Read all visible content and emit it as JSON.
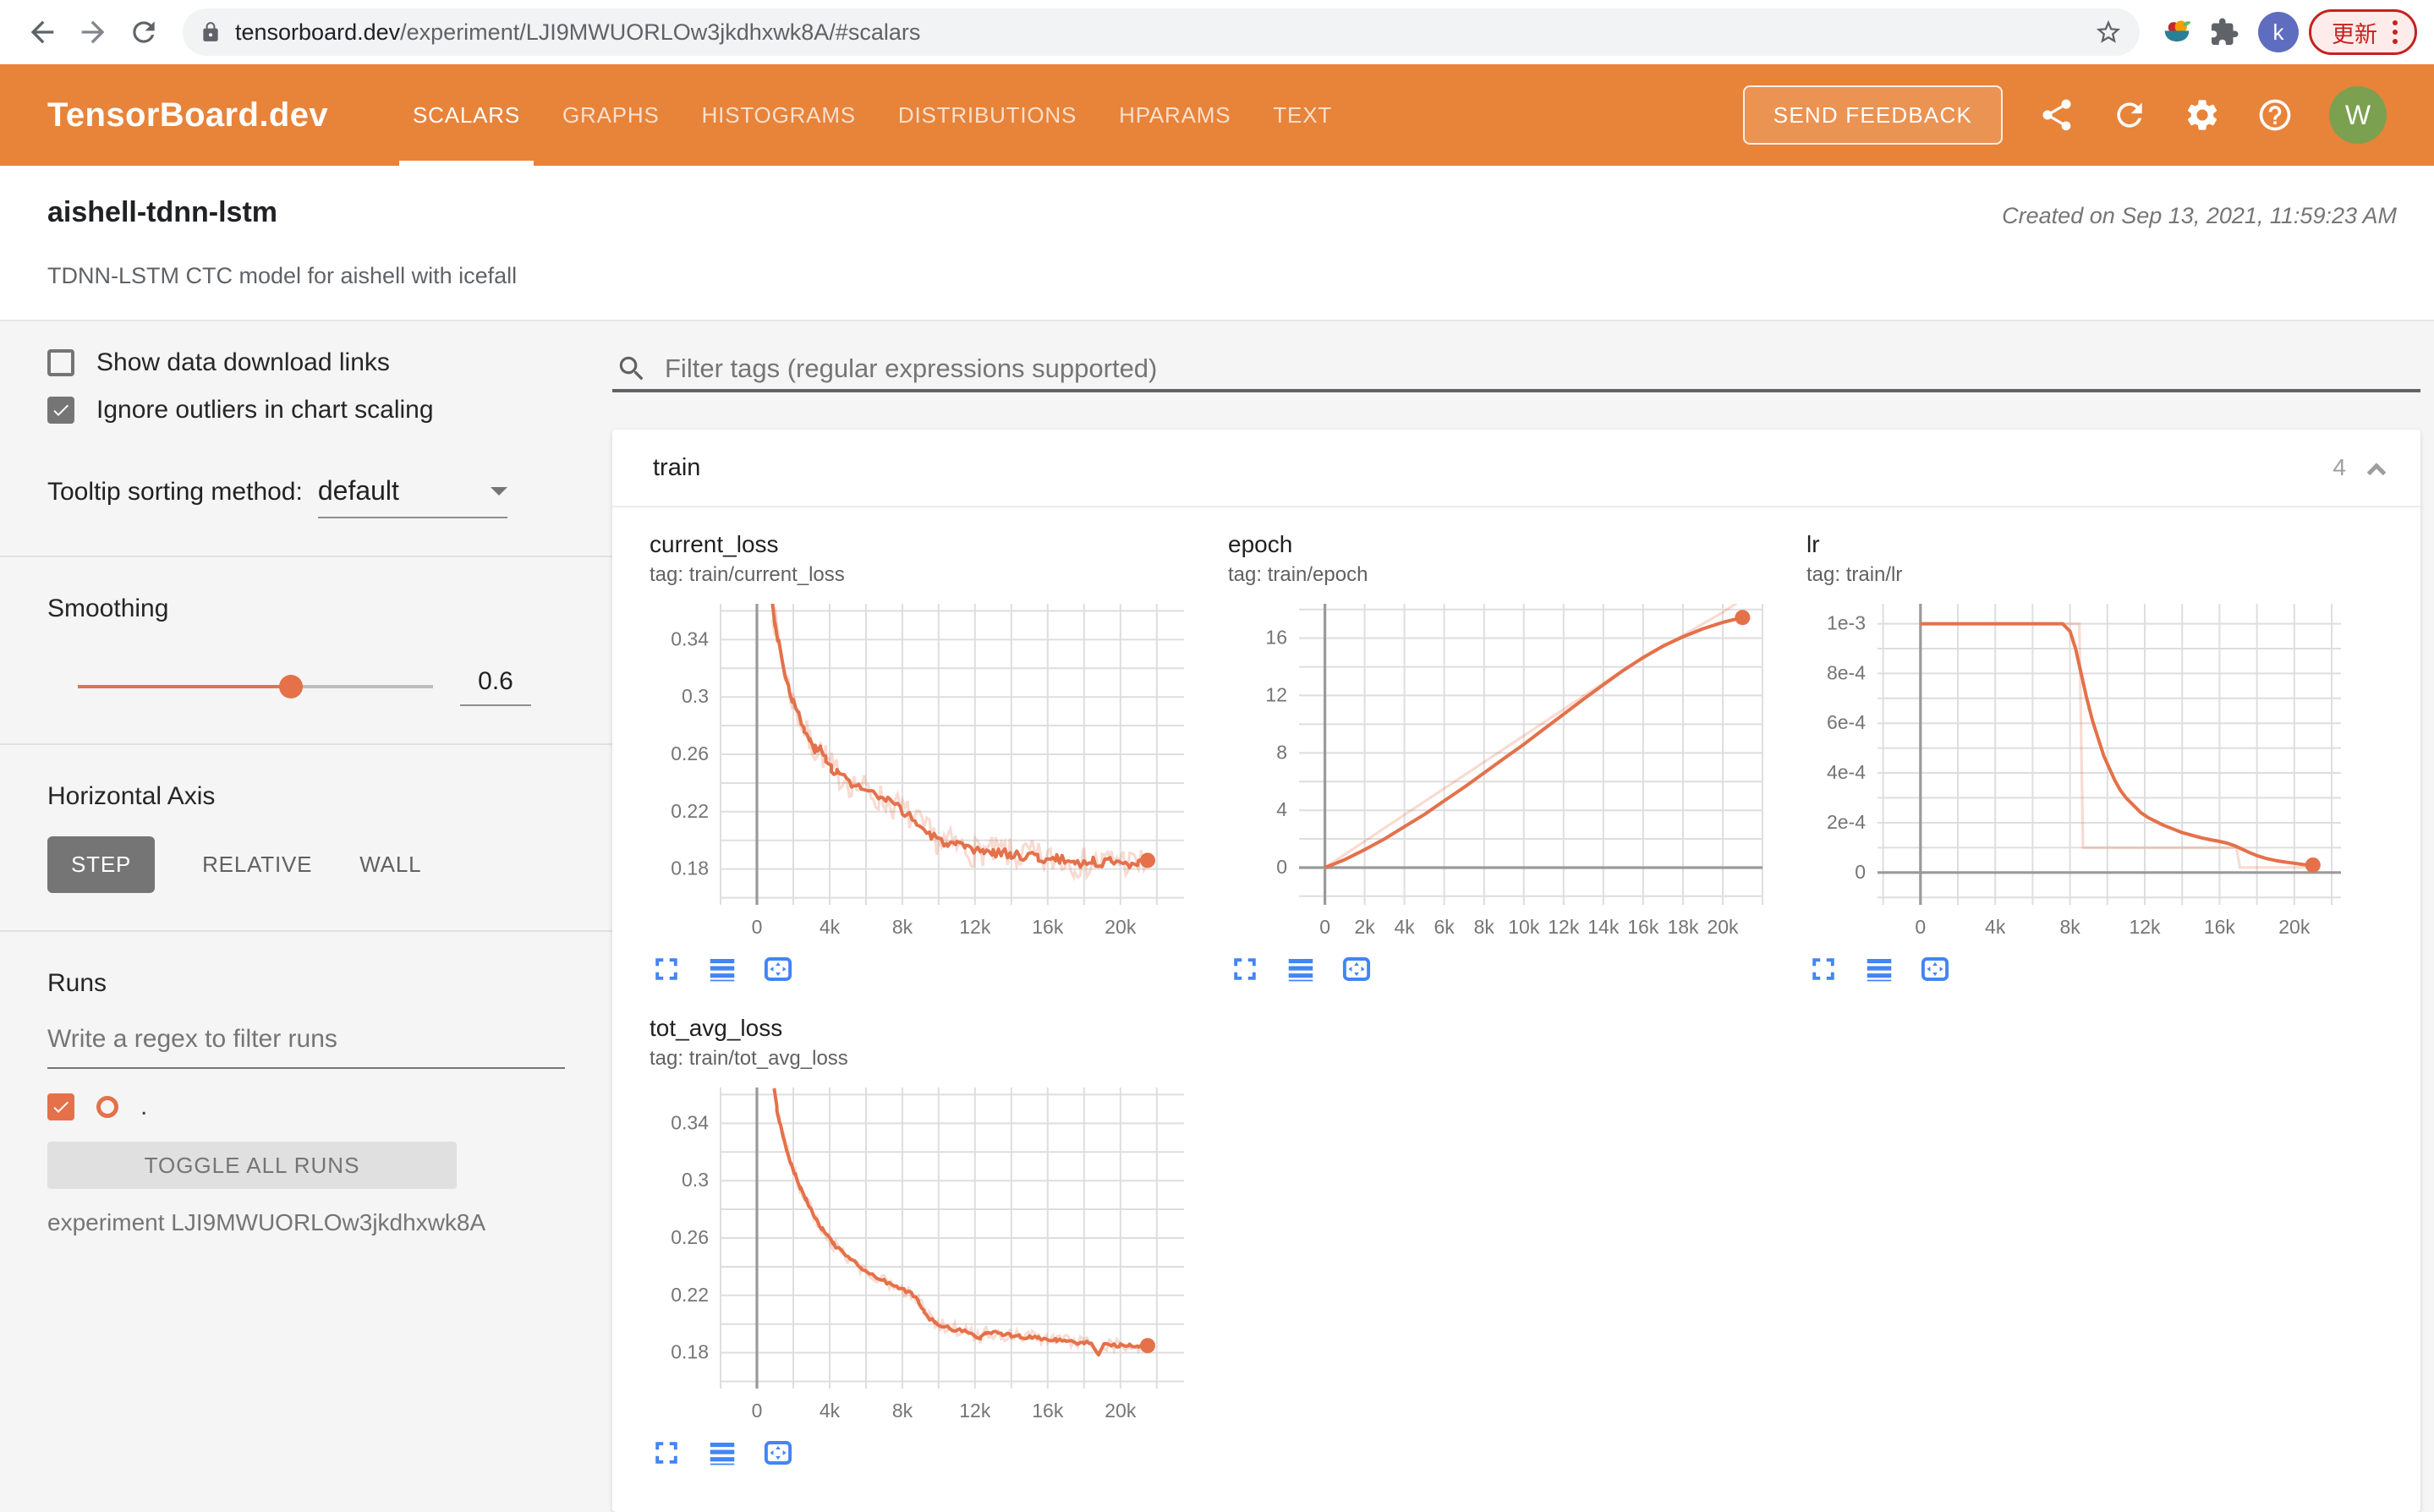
{
  "browser": {
    "url_domain": "tensorboard.dev",
    "url_path": "/experiment/LJI9MWUORLOw3jkdhxwk8A/#scalars",
    "profile_initial": "k",
    "update_button": "更新"
  },
  "header": {
    "logo": "TensorBoard.dev",
    "tabs": [
      {
        "label": "SCALARS",
        "active": true
      },
      {
        "label": "GRAPHS",
        "active": false
      },
      {
        "label": "HISTOGRAMS",
        "active": false
      },
      {
        "label": "DISTRIBUTIONS",
        "active": false
      },
      {
        "label": "HPARAMS",
        "active": false
      },
      {
        "label": "TEXT",
        "active": false
      }
    ],
    "feedback_button": "SEND FEEDBACK",
    "avatar_initial": "W"
  },
  "experiment": {
    "name": "aishell-tdnn-lstm",
    "description": "TDNN-LSTM CTC model for aishell with icefall",
    "created": "Created on Sep 13, 2021, 11:59:23 AM"
  },
  "sidebar": {
    "show_download_label": "Show data download links",
    "ignore_outliers_label": "Ignore outliers in chart scaling",
    "tooltip_sort_label": "Tooltip sorting method:",
    "tooltip_sort_value": "default",
    "smoothing_label": "Smoothing",
    "smoothing_value": "0.6",
    "horizontal_axis_label": "Horizontal Axis",
    "axis_options": [
      {
        "label": "STEP",
        "active": true
      },
      {
        "label": "RELATIVE",
        "active": false
      },
      {
        "label": "WALL",
        "active": false
      }
    ],
    "runs_label": "Runs",
    "runs_filter_placeholder": "Write a regex to filter runs",
    "run_name": ".",
    "toggle_all_label": "TOGGLE ALL RUNS",
    "experiment_label": "experiment LJI9MWUORLOw3jkdhxwk8A"
  },
  "main": {
    "filter_placeholder": "Filter tags (regular expressions supported)",
    "section": {
      "title": "train",
      "count": "4"
    }
  },
  "colors": {
    "header_orange": "#e8833a",
    "series_orange": "#e4714a",
    "icon_blue": "#4285f4",
    "grid": "#dedede",
    "zero_axis": "#9a9a9a",
    "tick_label": "#757575"
  },
  "chart_data": [
    {
      "id": "current_loss",
      "type": "line",
      "title": "current_loss",
      "tag": "tag: train/current_loss",
      "xlim": [
        -2000,
        23500
      ],
      "ylim": [
        0.155,
        0.365
      ],
      "x_grid": 2000,
      "y_grid": 0.02,
      "x_ticks": [
        [
          0,
          "0"
        ],
        [
          4000,
          "4k"
        ],
        [
          8000,
          "8k"
        ],
        [
          12000,
          "12k"
        ],
        [
          16000,
          "16k"
        ],
        [
          20000,
          "20k"
        ]
      ],
      "y_ticks": [
        [
          0.18,
          "0.18"
        ],
        [
          0.22,
          "0.22"
        ],
        [
          0.26,
          "0.26"
        ],
        [
          0.3,
          "0.3"
        ],
        [
          0.34,
          "0.34"
        ]
      ],
      "zero_x": true,
      "zero_y": false,
      "line_noise": 0.0032,
      "raw_noise": 0.011,
      "raw": null,
      "end_dot": true,
      "smoothed": [
        [
          850,
          0.365
        ],
        [
          1000,
          0.352
        ],
        [
          1200,
          0.338
        ],
        [
          1400,
          0.325
        ],
        [
          1600,
          0.314
        ],
        [
          1800,
          0.305
        ],
        [
          2000,
          0.297
        ],
        [
          2300,
          0.287
        ],
        [
          2600,
          0.277
        ],
        [
          2900,
          0.269
        ],
        [
          3200,
          0.264
        ],
        [
          3500,
          0.263
        ],
        [
          3800,
          0.257
        ],
        [
          4100,
          0.251
        ],
        [
          4400,
          0.247
        ],
        [
          4800,
          0.244
        ],
        [
          5200,
          0.24
        ],
        [
          5600,
          0.237
        ],
        [
          6000,
          0.235
        ],
        [
          6400,
          0.232
        ],
        [
          6800,
          0.229
        ],
        [
          7200,
          0.227
        ],
        [
          7600,
          0.224
        ],
        [
          8000,
          0.221
        ],
        [
          8400,
          0.217
        ],
        [
          8800,
          0.212
        ],
        [
          9200,
          0.207
        ],
        [
          9600,
          0.203
        ],
        [
          10000,
          0.2
        ],
        [
          10500,
          0.198
        ],
        [
          11000,
          0.196
        ],
        [
          11500,
          0.194
        ],
        [
          12000,
          0.192
        ],
        [
          12500,
          0.193
        ],
        [
          13000,
          0.191
        ],
        [
          13500,
          0.192
        ],
        [
          14000,
          0.19
        ],
        [
          14500,
          0.189
        ],
        [
          15000,
          0.19
        ],
        [
          15500,
          0.188
        ],
        [
          16000,
          0.186
        ],
        [
          16500,
          0.187
        ],
        [
          17000,
          0.186
        ],
        [
          17500,
          0.185
        ],
        [
          18000,
          0.184
        ],
        [
          18500,
          0.185
        ],
        [
          19000,
          0.184
        ],
        [
          19500,
          0.186
        ],
        [
          20000,
          0.187
        ],
        [
          20500,
          0.184
        ],
        [
          21000,
          0.183
        ],
        [
          21500,
          0.186
        ]
      ]
    },
    {
      "id": "epoch",
      "type": "line",
      "title": "epoch",
      "tag": "tag: train/epoch",
      "xlim": [
        -1300,
        22000
      ],
      "ylim": [
        -2.6,
        18.4
      ],
      "x_grid": 2000,
      "y_grid": 2,
      "x_ticks": [
        [
          0,
          "0"
        ],
        [
          2000,
          "2k"
        ],
        [
          4000,
          "4k"
        ],
        [
          6000,
          "6k"
        ],
        [
          8000,
          "8k"
        ],
        [
          10000,
          "10k"
        ],
        [
          12000,
          "12k"
        ],
        [
          14000,
          "14k"
        ],
        [
          16000,
          "16k"
        ],
        [
          18000,
          "18k"
        ],
        [
          20000,
          "20k"
        ]
      ],
      "y_ticks": [
        [
          0,
          "0"
        ],
        [
          4,
          "4"
        ],
        [
          8,
          "8"
        ],
        [
          12,
          "12"
        ],
        [
          16,
          "16"
        ]
      ],
      "zero_x": true,
      "zero_y": true,
      "line_noise": 0,
      "raw_noise": 0,
      "end_dot": true,
      "raw": [
        [
          0,
          0
        ],
        [
          5000,
          4.6
        ],
        [
          10000,
          9.2
        ],
        [
          15000,
          13.8
        ],
        [
          20000,
          17.8
        ],
        [
          21300,
          19
        ]
      ],
      "smoothed": [
        [
          0,
          0
        ],
        [
          1000,
          0.55
        ],
        [
          2000,
          1.25
        ],
        [
          3000,
          2
        ],
        [
          4000,
          2.85
        ],
        [
          5000,
          3.7
        ],
        [
          6000,
          4.65
        ],
        [
          7000,
          5.6
        ],
        [
          8000,
          6.6
        ],
        [
          9000,
          7.6
        ],
        [
          10000,
          8.6
        ],
        [
          11000,
          9.65
        ],
        [
          12000,
          10.7
        ],
        [
          13000,
          11.75
        ],
        [
          14000,
          12.75
        ],
        [
          15000,
          13.75
        ],
        [
          16000,
          14.65
        ],
        [
          17000,
          15.45
        ],
        [
          18000,
          16.1
        ],
        [
          19000,
          16.65
        ],
        [
          20000,
          17.1
        ],
        [
          21000,
          17.45
        ]
      ]
    },
    {
      "id": "lr",
      "type": "line",
      "title": "lr",
      "tag": "tag: train/lr",
      "xlim": [
        -2300,
        22500
      ],
      "ylim": [
        -0.00013,
        0.00108
      ],
      "x_grid": 2000,
      "y_grid": 0.0001,
      "x_ticks": [
        [
          0,
          "0"
        ],
        [
          4000,
          "4k"
        ],
        [
          8000,
          "8k"
        ],
        [
          12000,
          "12k"
        ],
        [
          16000,
          "16k"
        ],
        [
          20000,
          "20k"
        ]
      ],
      "y_ticks": [
        [
          0,
          "0"
        ],
        [
          0.0002,
          "2e-4"
        ],
        [
          0.0004,
          "4e-4"
        ],
        [
          0.0006,
          "6e-4"
        ],
        [
          0.0008,
          "8e-4"
        ],
        [
          0.001,
          "1e-3"
        ]
      ],
      "zero_x": true,
      "zero_y": true,
      "line_noise": 0,
      "raw_noise": 0,
      "end_dot": true,
      "raw": [
        [
          0,
          0.001
        ],
        [
          8500,
          0.001
        ],
        [
          8700,
          0.0001
        ],
        [
          16900,
          0.0001
        ],
        [
          17100,
          2e-05
        ],
        [
          21200,
          2e-05
        ]
      ],
      "smoothed": [
        [
          0,
          0.001
        ],
        [
          7600,
          0.001
        ],
        [
          8000,
          0.00097
        ],
        [
          8300,
          0.0009
        ],
        [
          8600,
          0.0008
        ],
        [
          8900,
          0.0007
        ],
        [
          9200,
          0.00061
        ],
        [
          9500,
          0.00054
        ],
        [
          9800,
          0.00047
        ],
        [
          10100,
          0.00042
        ],
        [
          10400,
          0.00037
        ],
        [
          10700,
          0.00033
        ],
        [
          11000,
          0.0003
        ],
        [
          11400,
          0.00027
        ],
        [
          11800,
          0.00024
        ],
        [
          12200,
          0.00022
        ],
        [
          12600,
          0.000205
        ],
        [
          13000,
          0.00019
        ],
        [
          13500,
          0.000175
        ],
        [
          14000,
          0.00016
        ],
        [
          14500,
          0.00015
        ],
        [
          15000,
          0.00014
        ],
        [
          15500,
          0.000132
        ],
        [
          16000,
          0.000125
        ],
        [
          16400,
          0.000118
        ],
        [
          16800,
          0.000108
        ],
        [
          17200,
          9.4e-05
        ],
        [
          17600,
          8e-05
        ],
        [
          18000,
          6.8e-05
        ],
        [
          18500,
          5.6e-05
        ],
        [
          19000,
          4.8e-05
        ],
        [
          19500,
          4.2e-05
        ],
        [
          20000,
          3.7e-05
        ],
        [
          20500,
          3.2e-05
        ],
        [
          21000,
          3e-05
        ]
      ]
    },
    {
      "id": "tot_avg_loss",
      "type": "line",
      "title": "tot_avg_loss",
      "tag": "tag: train/tot_avg_loss",
      "xlim": [
        -2000,
        23500
      ],
      "ylim": [
        0.155,
        0.365
      ],
      "x_grid": 2000,
      "y_grid": 0.02,
      "x_ticks": [
        [
          0,
          "0"
        ],
        [
          4000,
          "4k"
        ],
        [
          8000,
          "8k"
        ],
        [
          12000,
          "12k"
        ],
        [
          16000,
          "16k"
        ],
        [
          20000,
          "20k"
        ]
      ],
      "y_ticks": [
        [
          0.18,
          "0.18"
        ],
        [
          0.22,
          "0.22"
        ],
        [
          0.26,
          "0.26"
        ],
        [
          0.3,
          "0.3"
        ],
        [
          0.34,
          "0.34"
        ]
      ],
      "zero_x": true,
      "zero_y": false,
      "line_noise": 0.0013,
      "raw_noise": 0.0045,
      "raw": null,
      "end_dot": true,
      "smoothed": [
        [
          950,
          0.365
        ],
        [
          1100,
          0.35
        ],
        [
          1300,
          0.338
        ],
        [
          1500,
          0.328
        ],
        [
          1700,
          0.319
        ],
        [
          1900,
          0.311
        ],
        [
          2100,
          0.304
        ],
        [
          2400,
          0.295
        ],
        [
          2700,
          0.287
        ],
        [
          3000,
          0.279
        ],
        [
          3300,
          0.272
        ],
        [
          3600,
          0.266
        ],
        [
          3900,
          0.261
        ],
        [
          4200,
          0.256
        ],
        [
          4600,
          0.251
        ],
        [
          5000,
          0.247
        ],
        [
          5400,
          0.243
        ],
        [
          5800,
          0.239
        ],
        [
          6200,
          0.236
        ],
        [
          6600,
          0.233
        ],
        [
          7000,
          0.23
        ],
        [
          7400,
          0.227
        ],
        [
          7800,
          0.225
        ],
        [
          8200,
          0.223
        ],
        [
          8600,
          0.22
        ],
        [
          8900,
          0.216
        ],
        [
          9200,
          0.209
        ],
        [
          9500,
          0.204
        ],
        [
          9800,
          0.201
        ],
        [
          10200,
          0.199
        ],
        [
          10600,
          0.197
        ],
        [
          11000,
          0.196
        ],
        [
          11500,
          0.195
        ],
        [
          12000,
          0.192
        ],
        [
          12300,
          0.19
        ],
        [
          12600,
          0.194
        ],
        [
          13000,
          0.194
        ],
        [
          13500,
          0.193
        ],
        [
          14000,
          0.192
        ],
        [
          14500,
          0.191
        ],
        [
          15000,
          0.191
        ],
        [
          15500,
          0.19
        ],
        [
          16000,
          0.189
        ],
        [
          16500,
          0.189
        ],
        [
          17000,
          0.188
        ],
        [
          17500,
          0.187
        ],
        [
          18000,
          0.187
        ],
        [
          18400,
          0.186
        ],
        [
          18800,
          0.178
        ],
        [
          19100,
          0.186
        ],
        [
          19500,
          0.185
        ],
        [
          20000,
          0.185
        ],
        [
          20500,
          0.186
        ],
        [
          21000,
          0.184
        ],
        [
          21500,
          0.185
        ]
      ]
    }
  ]
}
